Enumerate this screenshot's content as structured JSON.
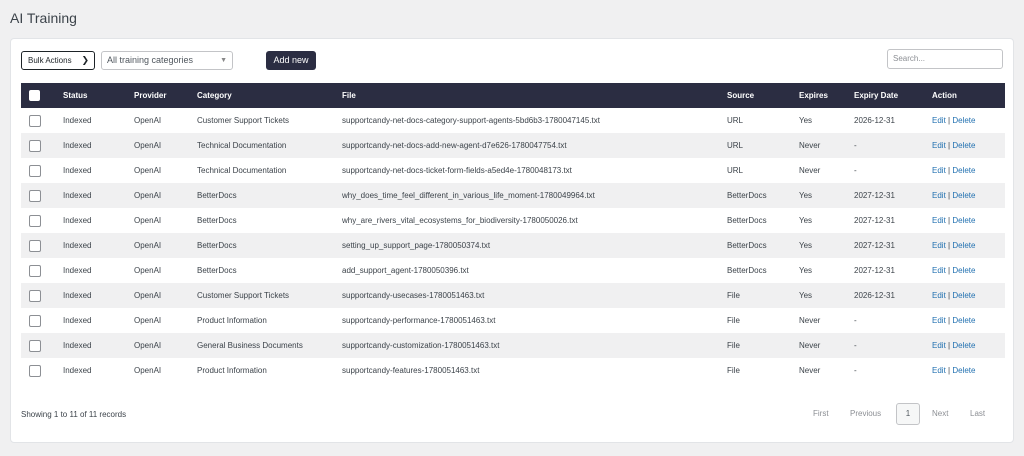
{
  "page": {
    "title": "AI Training"
  },
  "toolbar": {
    "bulk_actions": "Bulk Actions",
    "category_filter": "All training categories",
    "add_new": "Add new",
    "search_placeholder": "Search..."
  },
  "table": {
    "headers": [
      "Status",
      "Provider",
      "Category",
      "File",
      "Source",
      "Expires",
      "Expiry Date",
      "Action"
    ],
    "action_edit": "Edit",
    "action_sep": " | ",
    "action_delete": "Delete",
    "rows": [
      [
        "Indexed",
        "OpenAI",
        "Customer Support Tickets",
        "supportcandy-net-docs-category-support-agents-5bd6b3-1780047145.txt",
        "URL",
        "Yes",
        "2026-12-31"
      ],
      [
        "Indexed",
        "OpenAI",
        "Technical Documentation",
        "supportcandy-net-docs-add-new-agent-d7e626-1780047754.txt",
        "URL",
        "Never",
        "-"
      ],
      [
        "Indexed",
        "OpenAI",
        "Technical Documentation",
        "supportcandy-net-docs-ticket-form-fields-a5ed4e-1780048173.txt",
        "URL",
        "Never",
        "-"
      ],
      [
        "Indexed",
        "OpenAI",
        "BetterDocs",
        "why_does_time_feel_different_in_various_life_moment-1780049964.txt",
        "BetterDocs",
        "Yes",
        "2027-12-31"
      ],
      [
        "Indexed",
        "OpenAI",
        "BetterDocs",
        "why_are_rivers_vital_ecosystems_for_biodiversity-1780050026.txt",
        "BetterDocs",
        "Yes",
        "2027-12-31"
      ],
      [
        "Indexed",
        "OpenAI",
        "BetterDocs",
        "setting_up_support_page-1780050374.txt",
        "BetterDocs",
        "Yes",
        "2027-12-31"
      ],
      [
        "Indexed",
        "OpenAI",
        "BetterDocs",
        "add_support_agent-1780050396.txt",
        "BetterDocs",
        "Yes",
        "2027-12-31"
      ],
      [
        "Indexed",
        "OpenAI",
        "Customer Support Tickets",
        "supportcandy-usecases-1780051463.txt",
        "File",
        "Yes",
        "2026-12-31"
      ],
      [
        "Indexed",
        "OpenAI",
        "Product Information",
        "supportcandy-performance-1780051463.txt",
        "File",
        "Never",
        "-"
      ],
      [
        "Indexed",
        "OpenAI",
        "General Business Documents",
        "supportcandy-customization-1780051463.txt",
        "File",
        "Never",
        "-"
      ],
      [
        "Indexed",
        "OpenAI",
        "Product Information",
        "supportcandy-features-1780051463.txt",
        "File",
        "Never",
        "-"
      ]
    ]
  },
  "footer": {
    "showing": "Showing 1 to 11 of 11 records",
    "pager": {
      "first": "First",
      "previous": "Previous",
      "current": "1",
      "next": "Next",
      "last": "Last"
    }
  },
  "colors": {
    "header_bg": "#2b2d42",
    "link": "#2271b1",
    "page_bg": "#f0f0f1"
  }
}
